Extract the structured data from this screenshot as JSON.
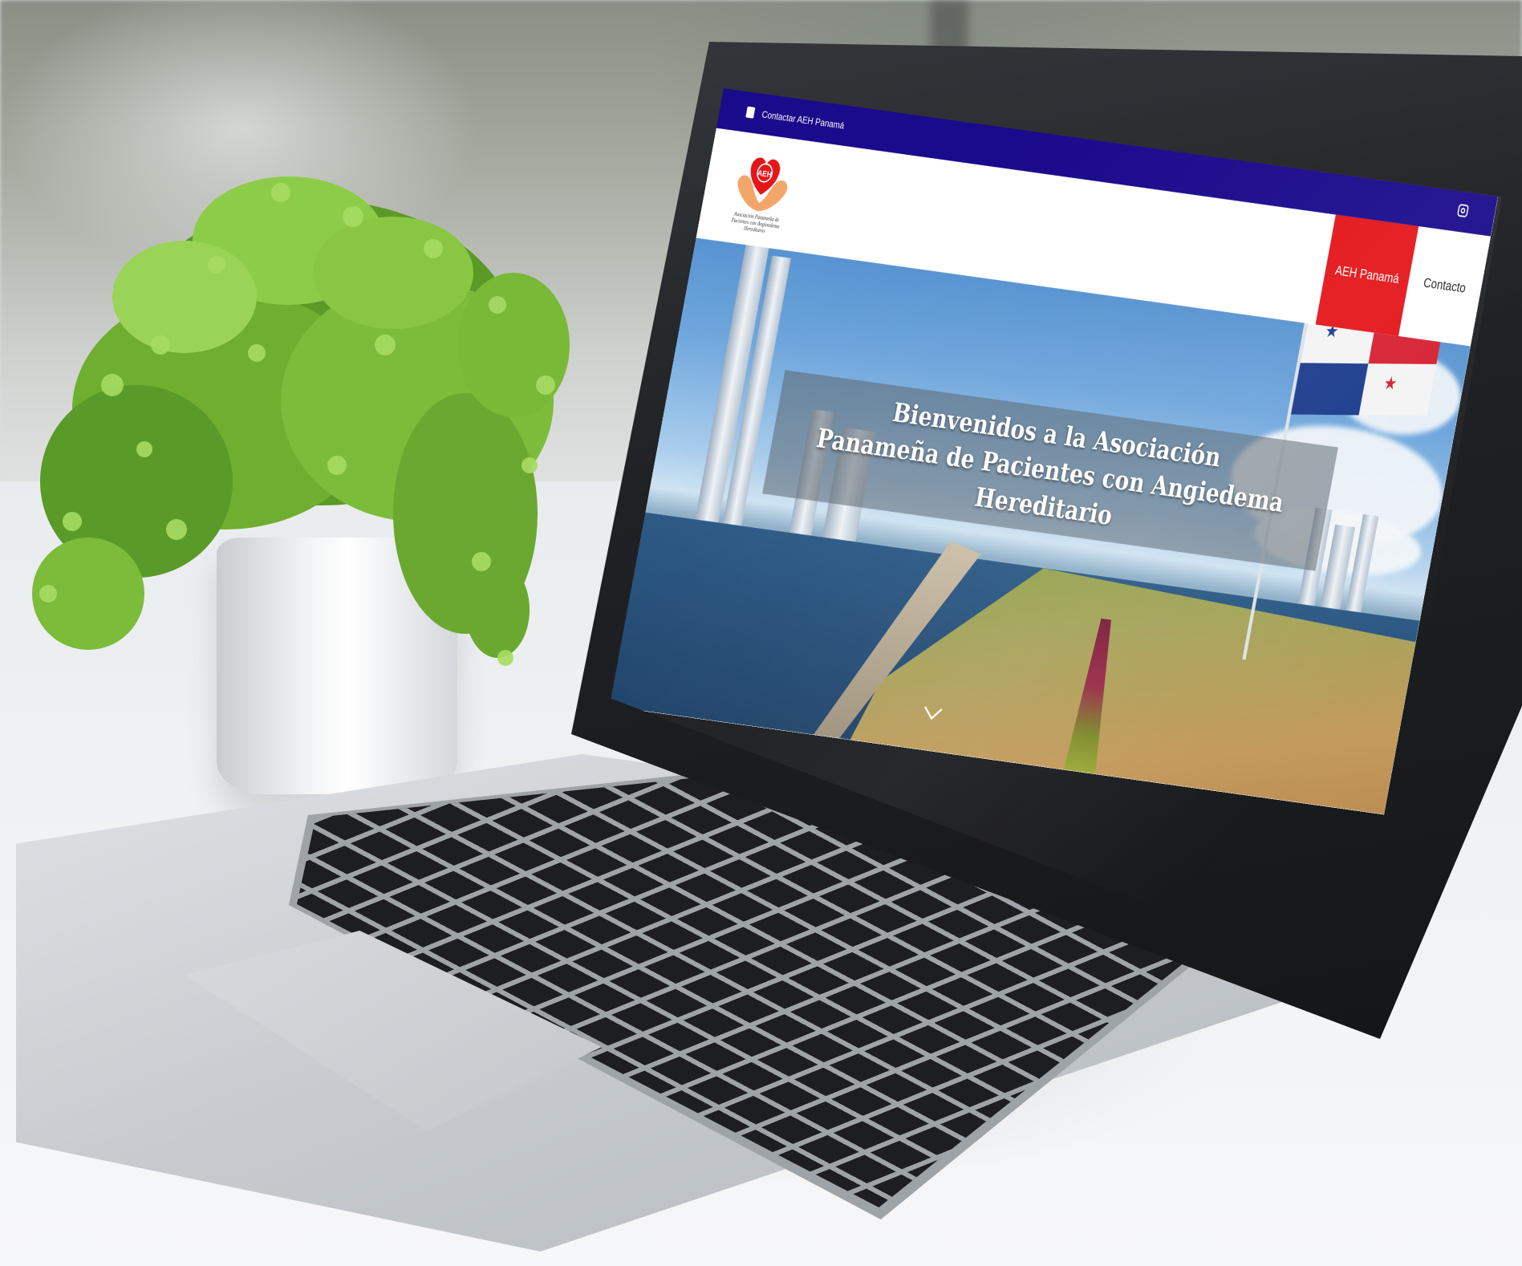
{
  "site": {
    "topbar": {
      "contact_label": "Contactar AEH Panamá",
      "social_icon": "instagram-icon"
    },
    "logo": {
      "badge_text": "AEH",
      "caption": "Asociación Panameña de Pacientes con Angioedema Hereditario"
    },
    "nav": {
      "items": [
        {
          "label": "AEH Panamá",
          "active": true
        },
        {
          "label": "Contacto",
          "active": false
        }
      ]
    },
    "hero": {
      "title_line1": "Bienvenidos a la Asociación",
      "title_line2": "Panameña de Pacientes con Angiedema Hereditario",
      "scroll_icon": "chevron-down-icon"
    },
    "colors": {
      "topbar": "#1a0a8c",
      "nav_active": "#e4161a",
      "logo_red": "#e4161a",
      "logo_hands": "#f2a66a"
    }
  }
}
